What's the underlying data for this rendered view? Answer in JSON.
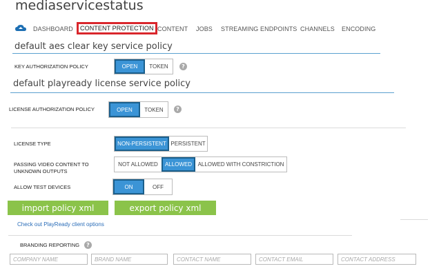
{
  "app_title": "mediaservicestatus",
  "nav": {
    "items": [
      "DASHBOARD",
      "CONTENT PROTECTION",
      "CONTENT",
      "JOBS",
      "STREAMING ENDPOINTS",
      "CHANNELS",
      "ENCODING"
    ]
  },
  "aes_policy": {
    "title": "default aes clear key service policy",
    "key_auth_label": "KEY AUTHORIZATION POLICY",
    "options": [
      "OPEN",
      "TOKEN"
    ],
    "selected": "OPEN"
  },
  "playready_policy": {
    "title": "default playready license service policy",
    "license_auth_label": "LICENSE AUTHORIZATION POLICY",
    "options": [
      "OPEN",
      "TOKEN"
    ],
    "selected": "OPEN"
  },
  "license_type": {
    "label": "LICENSE TYPE",
    "options": [
      "NON-PERSISTENT",
      "PERSISTENT"
    ],
    "selected": "NON-PERSISTENT"
  },
  "passing_video": {
    "label_line1": "PASSING VIDEO CONTENT TO",
    "label_line2": "UNKNOWN OUTPUTS",
    "options": [
      "NOT ALLOWED",
      "ALLOWED",
      "ALLOWED WITH CONSTRICTION"
    ],
    "selected": "ALLOWED"
  },
  "allow_test_devices": {
    "label": "ALLOW TEST DEVICES",
    "options": [
      "ON",
      "OFF"
    ],
    "selected": "ON"
  },
  "buttons": {
    "import_label": "import policy xml",
    "export_label": "export policy xml"
  },
  "playready_link": "Check out PlayReady client options",
  "branding": {
    "label": "BRANDING REPORTING",
    "placeholders": [
      "COMPANY NAME",
      "BRAND NAME",
      "CONTACT NAME",
      "CONTACT EMAIL",
      "CONTACT ADDRESS"
    ]
  },
  "colors": {
    "accent": "#3b94d6",
    "highlight_box": "#d9262c",
    "button_green": "#8bc34a"
  }
}
